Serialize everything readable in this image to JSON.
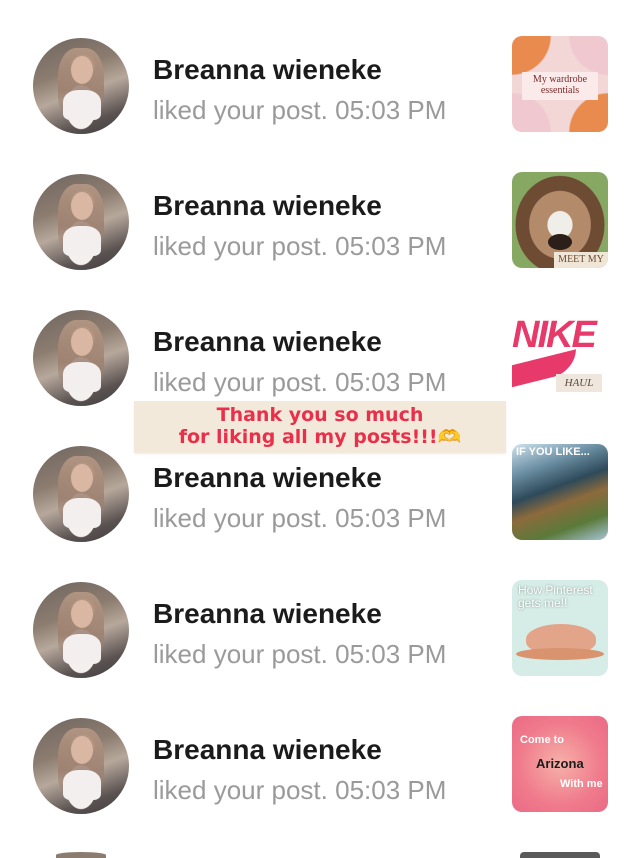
{
  "notifications": [
    {
      "name": "Breanna wieneke",
      "action": "liked your post.",
      "time": "05:03 PM",
      "thumb": "wardrobe",
      "thumb_text": "My wardrobe essentials"
    },
    {
      "name": "Breanna wieneke",
      "action": "liked your post.",
      "time": "05:03 PM",
      "thumb": "dog",
      "thumb_text": "MEET MY"
    },
    {
      "name": "Breanna wieneke",
      "action": "liked your post.",
      "time": "05:03 PM",
      "thumb": "nike",
      "thumb_text": "NIKE",
      "thumb_text2": "HAUL"
    },
    {
      "name": "Breanna wieneke",
      "action": "liked your post.",
      "time": "05:03 PM",
      "thumb": "waterfall",
      "thumb_text": "IF YOU LIKE..."
    },
    {
      "name": "Breanna wieneke",
      "action": "liked your post.",
      "time": "05:03 PM",
      "thumb": "hat",
      "thumb_text": "How Pinterest gets me!!"
    },
    {
      "name": "Breanna wieneke",
      "action": "liked your post.",
      "time": "05:03 PM",
      "thumb": "arizona",
      "thumb_text": "Come to",
      "thumb_text2": "Arizona",
      "thumb_text3": "With me"
    }
  ],
  "banner": {
    "line1": "Thank you so much",
    "line2": "for liking all my posts!!!",
    "emoji": "🫶"
  },
  "colors": {
    "name": "#1b1b1b",
    "meta": "#9a9a9a",
    "banner_text": "#ea2f4a",
    "banner_bg": "#f2e9da"
  }
}
